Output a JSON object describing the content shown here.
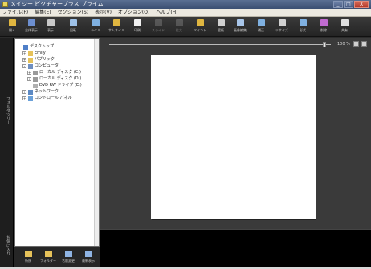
{
  "window": {
    "title": "メイシー ピクチャープラス プライム",
    "minimize": "_",
    "maximize": "□",
    "close": "X"
  },
  "menu": [
    {
      "label": "ファイル(F)"
    },
    {
      "label": "編集(E)"
    },
    {
      "label": "セクション(S)"
    },
    {
      "label": "表示(V)"
    },
    {
      "label": "オプション(O)"
    },
    {
      "label": "ヘルプ(H)"
    }
  ],
  "toolbar": [
    {
      "label": "開く",
      "icon": "open-icon",
      "color": "#e0b640"
    },
    {
      "label": "全体表示",
      "icon": "overview-icon",
      "color": "#6d8fd0"
    },
    {
      "label": "表示",
      "icon": "view-icon",
      "color": "#c9c9c9"
    },
    {
      "label": "回転",
      "icon": "rotate-icon",
      "color": "#9ec1e8"
    },
    {
      "label": "ラベル",
      "icon": "label-icon",
      "color": "#7fb0e0"
    },
    {
      "label": "サムネイル",
      "icon": "thumbnail-icon",
      "color": "#e0b640"
    },
    {
      "label": "印刷",
      "icon": "print-icon",
      "color": "#f0f0f0"
    },
    {
      "label": "スライド",
      "icon": "slideshow-icon",
      "color": "#9a9a9a",
      "disabled": true
    },
    {
      "label": "拡大",
      "icon": "zoom-icon",
      "color": "#9a9a9a",
      "disabled": true
    },
    {
      "label": "ペイント",
      "icon": "paint-icon",
      "color": "#e0b640"
    },
    {
      "label": "壁紙",
      "icon": "wallpaper-icon",
      "color": "#d0d0d0"
    },
    {
      "label": "画像編集",
      "icon": "image-edit-icon",
      "color": "#a9c6ea"
    },
    {
      "label": "補正",
      "icon": "correct-icon",
      "color": "#7fb0e0"
    },
    {
      "label": "リサイズ",
      "icon": "resize-icon",
      "color": "#d0d0d0"
    },
    {
      "label": "形式",
      "icon": "format-icon",
      "color": "#7fb0e0"
    },
    {
      "label": "削除",
      "icon": "delete-icon",
      "color": "#c06bd0"
    },
    {
      "label": "共有",
      "icon": "share-icon",
      "color": "#e0e0e0"
    }
  ],
  "rail": {
    "tab_top": "フォルダツリー",
    "tab_bottom": "お気に入り"
  },
  "tree": [
    {
      "label": "デスクトップ",
      "icon": "desktop-icon",
      "depth": 0,
      "expander": "",
      "color": "#4f7fc8"
    },
    {
      "label": "Emily",
      "icon": "folder-icon",
      "depth": 1,
      "expander": "+",
      "color": "#e6c25a"
    },
    {
      "label": "パブリック",
      "icon": "folder-icon",
      "depth": 1,
      "expander": "+",
      "color": "#e6c25a"
    },
    {
      "label": "コンピュータ",
      "icon": "computer-icon",
      "depth": 1,
      "expander": "-",
      "color": "#6f8fc0"
    },
    {
      "label": "ローカル ディスク (C:)",
      "icon": "drive-icon",
      "depth": 2,
      "expander": "+",
      "color": "#9a9a9a"
    },
    {
      "label": "ローカル ディスク (D:)",
      "icon": "drive-icon",
      "depth": 2,
      "expander": "+",
      "color": "#9a9a9a"
    },
    {
      "label": "DVD RW ドライブ (E:)",
      "icon": "dvd-drive-icon",
      "depth": 2,
      "expander": "",
      "color": "#b0b0b0"
    },
    {
      "label": "ネットワーク",
      "icon": "network-icon",
      "depth": 1,
      "expander": "+",
      "color": "#5d8ac4"
    },
    {
      "label": "コントロール パネル",
      "icon": "control-panel-icon",
      "depth": 1,
      "expander": "+",
      "color": "#6aa0d8"
    }
  ],
  "tree_toolbar": [
    {
      "label": "新規",
      "icon": "new-folder-icon",
      "color": "#e6c25a"
    },
    {
      "label": "フォルダー",
      "icon": "folder-icon",
      "color": "#e6c25a"
    },
    {
      "label": "名前変更",
      "icon": "rename-icon",
      "color": "#8fb4e4"
    },
    {
      "label": "最新表示",
      "icon": "refresh-icon",
      "color": "#8fb4e4"
    }
  ],
  "preview": {
    "zoom_value": "100 %"
  }
}
